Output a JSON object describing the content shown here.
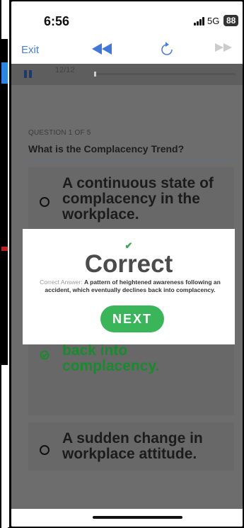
{
  "status": {
    "time": "6:56",
    "network": "5G",
    "battery": "88"
  },
  "toolbar": {
    "exit_label": "Exit"
  },
  "progress": {
    "count": "12/12",
    "fraction": 0.0
  },
  "question": {
    "number_label": "QUESTION 1 OF 5",
    "text": "What is the Complacency Trend?"
  },
  "options": [
    {
      "text": "A continuous state of complacency in the workplace.",
      "state": "unselected"
    },
    {
      "text": "A pattern of heightened awareness following an accident, which eventually declines back into complacency.",
      "state": "correct"
    },
    {
      "text": "A sudden change in workplace attitude.",
      "state": "unselected"
    }
  ],
  "modal": {
    "title": "Correct",
    "answer_label": "Correct Answer:",
    "answer_text": "A pattern of heightened awareness following an accident, which eventually declines back into complacency.",
    "next_label": "NEXT"
  },
  "colors": {
    "accent_blue": "#4a7fd6",
    "correct_green": "#1a8a2e",
    "button_green": "#3ab55a"
  }
}
